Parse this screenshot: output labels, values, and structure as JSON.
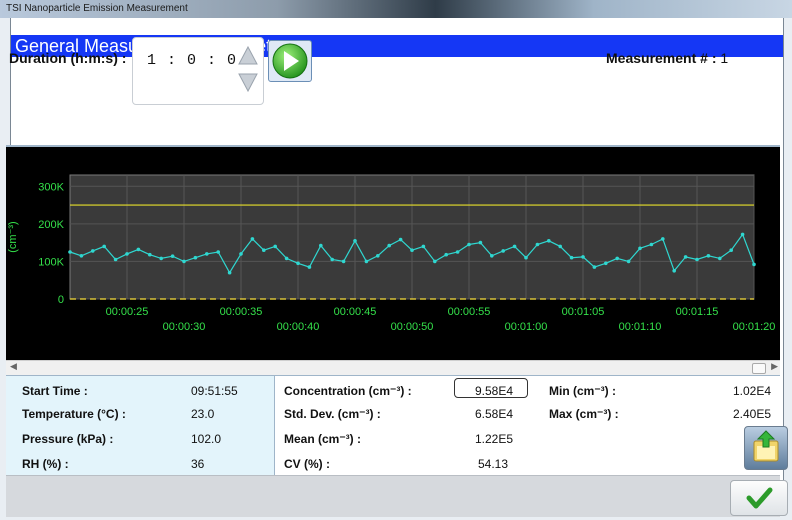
{
  "window": {
    "title": "TSI Nanoparticle Emission Measurement"
  },
  "header": {
    "title": "General Measurement: Complete"
  },
  "duration": {
    "label": "Duration (h:m:s) :",
    "value": "1 : 0 : 0"
  },
  "measurement": {
    "label": "Measurement # :",
    "value": "1"
  },
  "icons": {
    "play": "play-icon",
    "spin_up": "arrow-up-icon",
    "spin_down": "arrow-down-icon",
    "export": "export-icon",
    "ok": "checkmark-icon"
  },
  "colors": {
    "header_bg": "#1537f5",
    "plot_bg": "#3a3a3a",
    "series": "#2fd7d0",
    "limit_line": "#e8e02a",
    "zero_line": "#d8c23a",
    "axis_text": "#34e04a",
    "stats_left_bg": "#e3f4fb"
  },
  "chart_data": {
    "type": "line",
    "ylabel": "(cm⁻³)",
    "y_ticks": [
      "0",
      "100K",
      "200K",
      "300K"
    ],
    "ylim": [
      0,
      330000
    ],
    "x_ticks": [
      "00:00:25",
      "00:00:30",
      "00:00:35",
      "00:00:40",
      "00:00:45",
      "00:00:50",
      "00:00:55",
      "00:01:00",
      "00:01:05",
      "00:01:10",
      "00:01:15",
      "00:01:20"
    ],
    "x_tick_seconds": [
      25,
      30,
      35,
      40,
      45,
      50,
      55,
      60,
      65,
      70,
      75,
      80
    ],
    "xlim": [
      20,
      80
    ],
    "limit_value": 250000,
    "zero_value": 0,
    "grid": true,
    "series": [
      {
        "values": [
          125000,
          115000,
          128000,
          140000,
          105000,
          120000,
          132000,
          118000,
          108000,
          114000,
          100000,
          110000,
          120000,
          125000,
          70000,
          120000,
          160000,
          130000,
          140000,
          108000,
          95000,
          85000,
          142000,
          105000,
          100000,
          155000,
          100000,
          115000,
          142000,
          158000,
          130000,
          140000,
          100000,
          118000,
          125000,
          145000,
          150000,
          115000,
          128000,
          140000,
          110000,
          145000,
          155000,
          140000,
          110000,
          112000,
          85000,
          95000,
          108000,
          100000,
          135000,
          145000,
          160000,
          75000,
          112000,
          105000,
          115000,
          108000,
          130000,
          172000,
          92000
        ]
      }
    ]
  },
  "stats": {
    "start_time_label": "Start Time :",
    "start_time": "09:51:55",
    "temperature_label": "Temperature (°C) :",
    "temperature": "23.0",
    "pressure_label": "Pressure (kPa) :",
    "pressure": "102.0",
    "rh_label": "RH (%) :",
    "rh": "36",
    "concentration_label": "Concentration  (cm⁻³) :",
    "concentration": "9.58E4",
    "std_dev_label": "Std. Dev.  (cm⁻³) :",
    "std_dev": "6.58E4",
    "mean_label": "Mean  (cm⁻³) :",
    "mean": "1.22E5",
    "cv_label": "CV (%) :",
    "cv": "54.13",
    "min_label": "Min  (cm⁻³) :",
    "min": "1.02E4",
    "max_label": "Max  (cm⁻³) :",
    "max": "2.40E5"
  }
}
